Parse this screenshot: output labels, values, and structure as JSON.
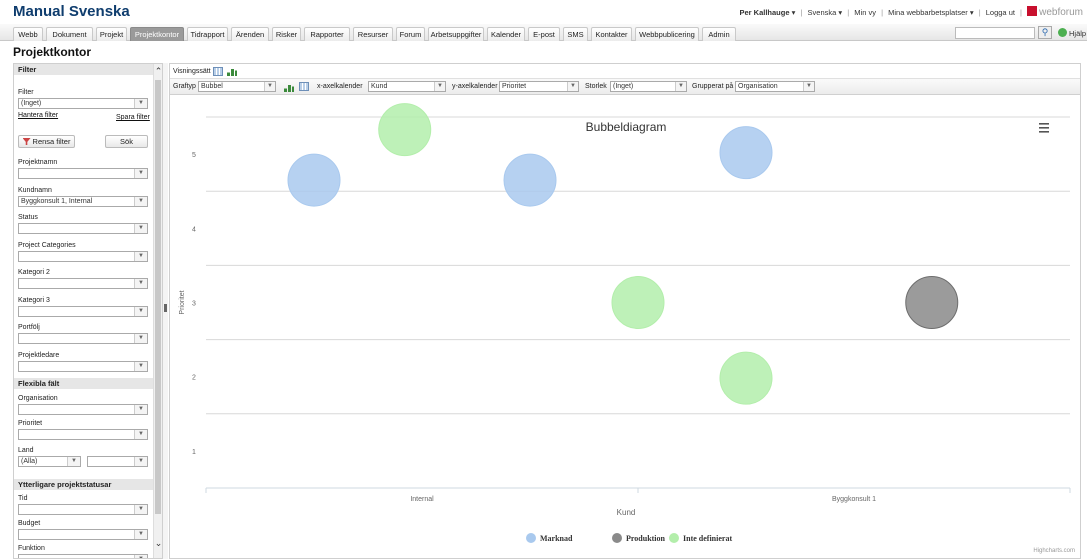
{
  "app": {
    "title": "Manual Svenska"
  },
  "userbar": {
    "user": "Per Kallhauge",
    "language": "Svenska",
    "my_view": "Min vy",
    "workspaces": "Mina webbarbetsplatser",
    "logout": "Logga ut",
    "brand": "webforum",
    "help": "Hjälp"
  },
  "nav": {
    "tabs": [
      {
        "label": "Webb"
      },
      {
        "label": "Dokument"
      },
      {
        "label": "Projekt"
      },
      {
        "label": "Projektkontor"
      },
      {
        "label": "Tidrapport"
      },
      {
        "label": "Ärenden"
      },
      {
        "label": "Risker"
      },
      {
        "label": "Rapporter"
      },
      {
        "label": "Resurser"
      },
      {
        "label": "Forum"
      },
      {
        "label": "Arbetsuppgifter"
      },
      {
        "label": "Kalender"
      },
      {
        "label": "E-post"
      },
      {
        "label": "SMS"
      },
      {
        "label": "Kontakter"
      },
      {
        "label": "Webbpublicering"
      },
      {
        "label": "Admin"
      }
    ],
    "active_index": 3
  },
  "page": {
    "title": "Projektkontor"
  },
  "sidebar": {
    "header": "Filter",
    "filter_label": "Filter",
    "filter_value": "(Inget)",
    "manage_filter": "Hantera filter",
    "save_filter": "Spara filter",
    "clear_filter": "Rensa filter",
    "search": "Sök",
    "fields": [
      {
        "label": "Projektnamn",
        "value": ""
      },
      {
        "label": "Kundnamn",
        "value": "Byggkonsult 1, Internal"
      },
      {
        "label": "Status",
        "value": ""
      },
      {
        "label": "Project Categories",
        "value": ""
      },
      {
        "label": "Kategori 2",
        "value": ""
      },
      {
        "label": "Kategori 3",
        "value": ""
      },
      {
        "label": "Portfölj",
        "value": ""
      },
      {
        "label": "Projektledare",
        "value": ""
      }
    ],
    "flex_header": "Flexibla fält",
    "flex_fields": [
      {
        "label": "Organisation",
        "value": ""
      },
      {
        "label": "Prioritet",
        "value": ""
      }
    ],
    "land_label": "Land",
    "land_value": "(Alla)",
    "land_value2": "",
    "more_header": "Ytterligare projektstatusar",
    "more_fields": [
      {
        "label": "Tid",
        "value": ""
      },
      {
        "label": "Budget",
        "value": ""
      },
      {
        "label": "Funktion",
        "value": ""
      }
    ]
  },
  "toolbar": {
    "view_mode": "Visningssätt",
    "graph_type_label": "Graftyp",
    "graph_type": "Bubbel",
    "x_label": "x-axelkalender",
    "x_value": "Kund",
    "y_label": "y-axelkalender",
    "y_value": "Prioritet",
    "size_label": "Storlek",
    "size_value": "(Inget)",
    "group_label": "Grupperat på",
    "group_value": "Organisation"
  },
  "chart_data": {
    "type": "bubble",
    "title": "Bubbeldiagram",
    "xlabel": "Kund",
    "ylabel": "Prioritet",
    "categories": [
      "Internal",
      "Byggkonsult 1"
    ],
    "yticks": [
      1,
      2,
      3,
      4,
      5
    ],
    "ylim": [
      0.5,
      5.5
    ],
    "grid": true,
    "legend_position": "bottom",
    "credits": "Highcharts.com",
    "series": [
      {
        "name": "Marknad",
        "color": "#a9c9ee",
        "points": [
          {
            "x": 0.25,
            "y": 4.65
          },
          {
            "x": 0.75,
            "y": 4.65
          },
          {
            "x": 1.25,
            "y": 5.02
          }
        ]
      },
      {
        "name": "Produktion",
        "color": "#8a8a8a",
        "points": [
          {
            "x": 1.68,
            "y": 3.0
          }
        ]
      },
      {
        "name": "Inte definierat",
        "color": "#b3eeab",
        "points": [
          {
            "x": 0.46,
            "y": 5.33
          },
          {
            "x": 1.0,
            "y": 3.0
          },
          {
            "x": 1.25,
            "y": 1.98
          }
        ]
      }
    ]
  }
}
